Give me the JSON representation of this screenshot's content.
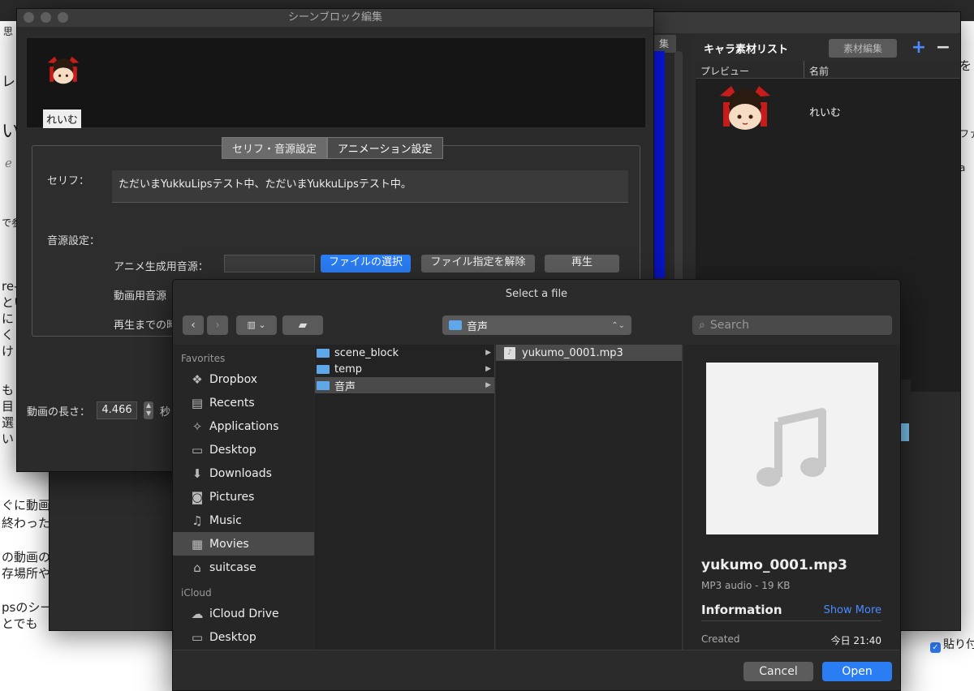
{
  "background": {
    "topbar_left": "思",
    "fragments": [
      "レ",
      "い",
      "ℯ",
      "で参",
      "re-",
      "とい",
      "に",
      "く",
      "け",
      "も",
      "目",
      "選",
      "い",
      "ぐに動画",
      "終わった",
      "の動画の",
      "存場所や",
      "psのシー",
      "とでも",
      "を",
      "ファ",
      "a"
    ],
    "checkbox_label": "貼り付"
  },
  "app": {
    "partial_tab": "集",
    "char_panel": {
      "title": "キャラ素材リスト",
      "edit_button": "素材編集",
      "col_preview": "プレビュー",
      "col_name": "名前",
      "character_name": "れいむ"
    },
    "colors": {
      "blue_bar": "#0b17e8",
      "highlight": "#7cc3ef"
    }
  },
  "scene": {
    "title": "シーンブロック編集",
    "avatar_name": "れいむ",
    "tabs": [
      "セリフ・音源設定",
      "アニメーション設定"
    ],
    "serif_label": "セリフ：",
    "serif_text": "ただいまYukkuLipsテスト中、ただいまYukkuLipsテスト中。",
    "audio_label": "音源設定：",
    "anim_audio_label": "アニメ生成用音源：",
    "video_audio_label": "動画用音源",
    "until_play_label": "再生までの時",
    "select_file_button": "ファイルの選択",
    "clear_file_button": "ファイル指定を解除",
    "play_button": "再生",
    "length_label": "動画の長さ：",
    "length_value": "4.466",
    "length_unit": "秒"
  },
  "dialog": {
    "title": "Select a file",
    "path": "音声",
    "search_placeholder": "Search",
    "favorites_header": "Favorites",
    "favorites": [
      {
        "label": "Dropbox",
        "icon": "dropbox-icon"
      },
      {
        "label": "Recents",
        "icon": "recents-icon"
      },
      {
        "label": "Applications",
        "icon": "applications-icon"
      },
      {
        "label": "Desktop",
        "icon": "desktop-icon"
      },
      {
        "label": "Downloads",
        "icon": "downloads-icon"
      },
      {
        "label": "Pictures",
        "icon": "pictures-icon"
      },
      {
        "label": "Music",
        "icon": "music-icon"
      },
      {
        "label": "Movies",
        "icon": "movies-icon"
      },
      {
        "label": "suitcase",
        "icon": "home-icon"
      }
    ],
    "icloud_header": "iCloud",
    "icloud": [
      {
        "label": "iCloud Drive",
        "icon": "cloud-icon"
      },
      {
        "label": "Desktop",
        "icon": "desktop-icon"
      }
    ],
    "folders": [
      "scene_block",
      "temp",
      "音声"
    ],
    "files": [
      "yukumo_0001.mp3"
    ],
    "preview": {
      "name": "yukumo_0001.mp3",
      "kind": "MP3 audio - 19 KB",
      "info_header": "Information",
      "show_more": "Show More",
      "created_label": "Created",
      "created_value": "今日 21:40"
    },
    "cancel_label": "Cancel",
    "open_label": "Open"
  }
}
